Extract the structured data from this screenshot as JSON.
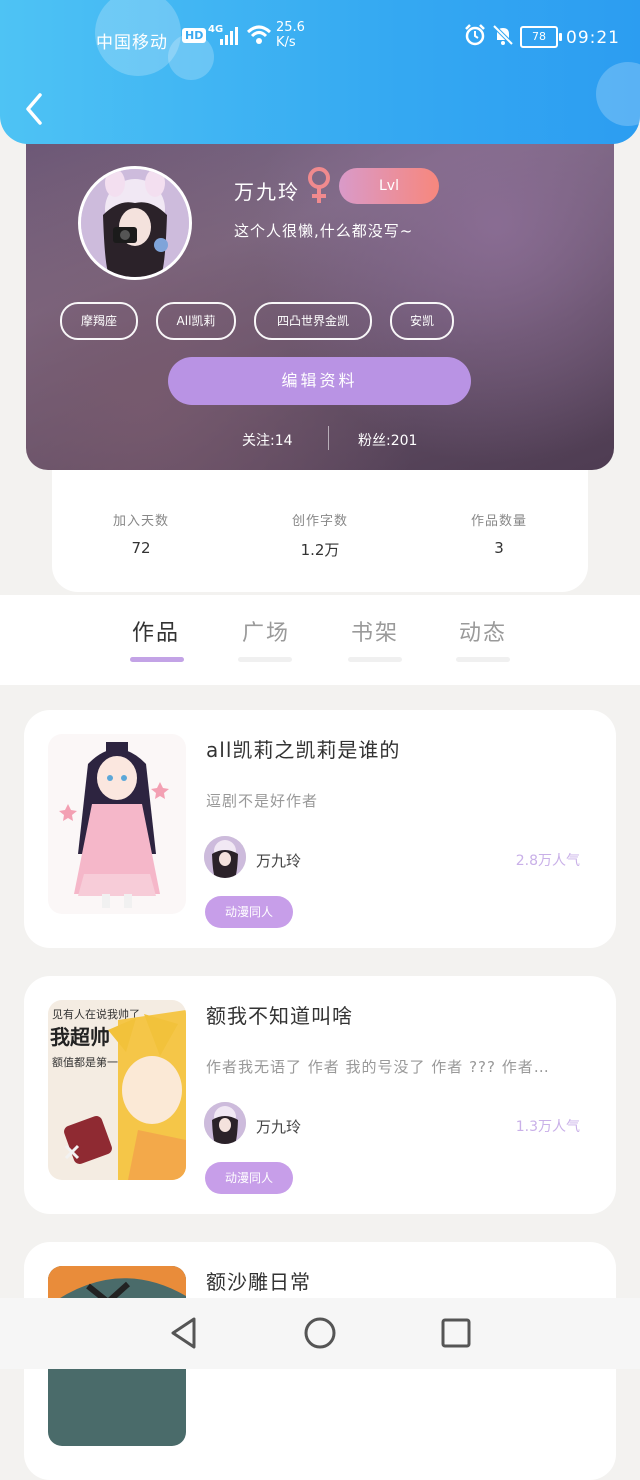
{
  "status_bar": {
    "carrier": "中国移动",
    "hd": "HD",
    "network": "4G",
    "speed_value": "25.6",
    "speed_unit": "K/s",
    "battery": "78",
    "time": "09:21"
  },
  "header": {
    "back_icon": "chevron-left-icon",
    "bg_color": "#35a9f2"
  },
  "profile": {
    "name": "万九玲",
    "gender_icon": "female-icon",
    "level": "Lvl",
    "signature": "这个人很懒,什么都没写~",
    "tags": [
      "摩羯座",
      "All凯莉",
      "四凸世界金凯",
      "安凯"
    ],
    "edit_button": "编辑资料",
    "follow": "关注:14",
    "fans": "粉丝:201"
  },
  "stats": [
    {
      "label": "加入天数",
      "value": "72"
    },
    {
      "label": "创作字数",
      "value": "1.2万"
    },
    {
      "label": "作品数量",
      "value": "3"
    }
  ],
  "tabs": [
    {
      "label": "作品",
      "active": true
    },
    {
      "label": "广场",
      "active": false
    },
    {
      "label": "书架",
      "active": false
    },
    {
      "label": "动态",
      "active": false
    }
  ],
  "works": [
    {
      "title": "all凯莉之凯莉是谁的",
      "desc": "逗剧不是好作者",
      "author": "万九玲",
      "popularity": "2.8万人气",
      "tag": "动漫同人"
    },
    {
      "title": "额我不知道叫啥",
      "desc": "作者我无语了 作者 我的号没了 作者 ??? 作者…",
      "author": "万九玲",
      "popularity": "1.3万人气",
      "tag": "动漫同人"
    },
    {
      "title": "额沙雕日常"
    }
  ],
  "cover2_text": [
    "见有人在说我帅了",
    "我超帅",
    "额值都是第一"
  ],
  "accent_color": "#c3a3e6"
}
